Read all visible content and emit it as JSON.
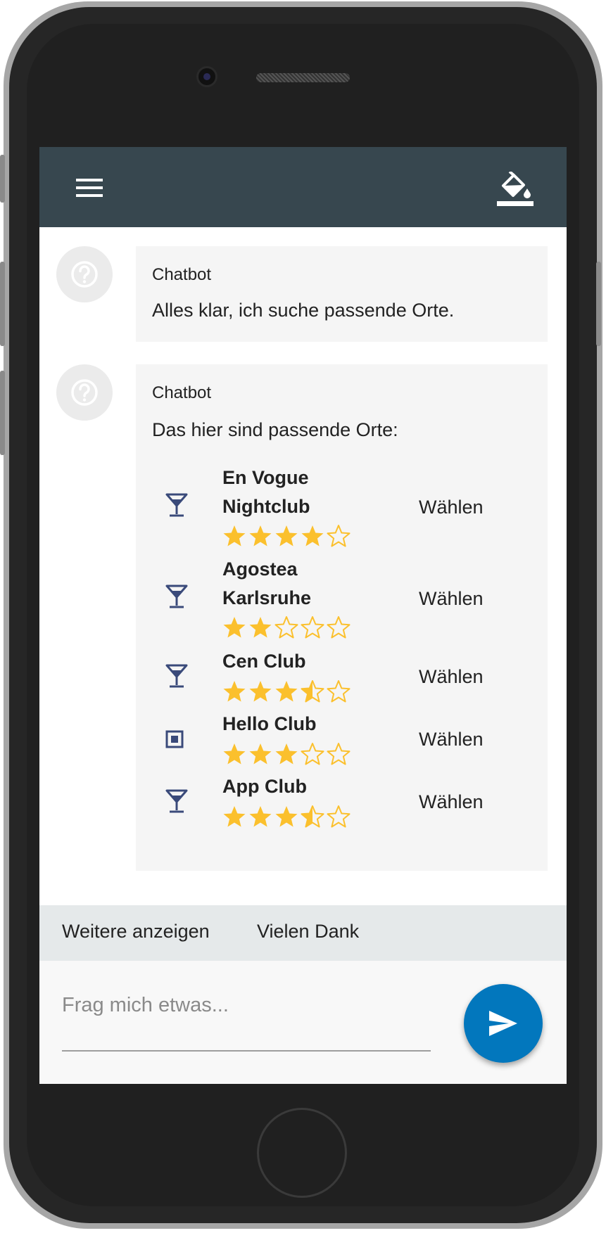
{
  "app": {
    "menu_icon": "menu-icon",
    "theme_icon": "format-color-fill-icon",
    "accent_color": "#37474f",
    "send_color": "#0277bd",
    "star_color": "#fbc02d"
  },
  "messages": [
    {
      "sender": "Chatbot",
      "avatar_icon": "help-circle-icon",
      "text": "Alles klar, ich suche passende Orte."
    },
    {
      "sender": "Chatbot",
      "avatar_icon": "help-circle-icon",
      "text": "Das hier sind passende Orte:",
      "places": [
        {
          "name_line1": "En Vogue",
          "name_line2": "Nightclub",
          "icon": "cocktail-bar-icon",
          "rating": 4,
          "choose_label": "Wählen"
        },
        {
          "name_line1": "Agostea",
          "name_line2": "Karlsruhe",
          "icon": "cocktail-bar-icon",
          "rating": 2,
          "choose_label": "Wählen"
        },
        {
          "name_line1": "Cen Club",
          "name_line2": "",
          "icon": "cocktail-bar-icon",
          "rating": 3.5,
          "choose_label": "Wählen"
        },
        {
          "name_line1": "Hello Club",
          "name_line2": "",
          "icon": "square-marker-icon",
          "rating": 3,
          "choose_label": "Wählen"
        },
        {
          "name_line1": "App Club",
          "name_line2": "",
          "icon": "cocktail-bar-icon",
          "rating": 3.5,
          "choose_label": "Wählen"
        }
      ]
    }
  ],
  "suggestions": [
    "Weitere anzeigen",
    "Vielen Dank"
  ],
  "input": {
    "placeholder": "Frag mich etwas...",
    "value": "",
    "send_icon": "send-icon"
  }
}
